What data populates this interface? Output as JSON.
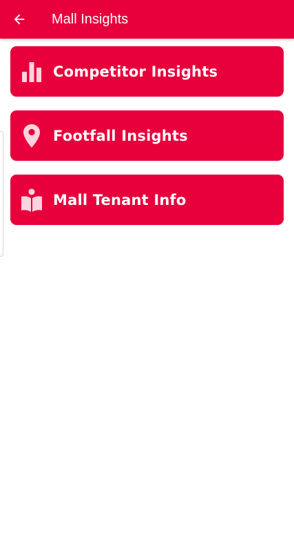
{
  "colors": {
    "accent": "#E8003C",
    "icon_tint": "#FFD3DE",
    "text_on_accent": "#FFFFFF"
  },
  "header": {
    "title": "Mall Insights",
    "back_icon": "arrow-left-icon"
  },
  "menu": {
    "items": [
      {
        "label": "Competitor Insights",
        "icon": "bar-chart-icon"
      },
      {
        "label": "Footfall Insights",
        "icon": "map-pin-icon"
      },
      {
        "label": "Mall Tenant Info",
        "icon": "reader-book-icon"
      }
    ]
  }
}
